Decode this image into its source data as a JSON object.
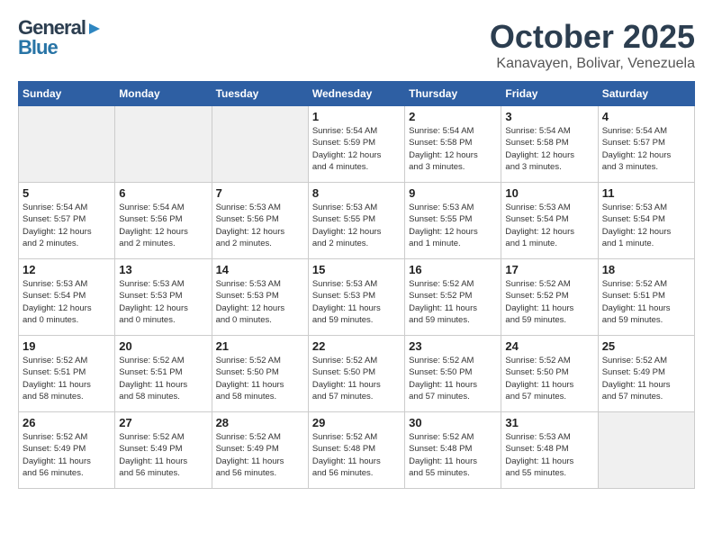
{
  "header": {
    "logo_general": "General",
    "logo_blue": "Blue",
    "month_title": "October 2025",
    "location": "Kanavayen, Bolivar, Venezuela"
  },
  "weekdays": [
    "Sunday",
    "Monday",
    "Tuesday",
    "Wednesday",
    "Thursday",
    "Friday",
    "Saturday"
  ],
  "weeks": [
    [
      {
        "num": "",
        "info": "",
        "empty": true
      },
      {
        "num": "",
        "info": "",
        "empty": true
      },
      {
        "num": "",
        "info": "",
        "empty": true
      },
      {
        "num": "1",
        "info": "Sunrise: 5:54 AM\nSunset: 5:59 PM\nDaylight: 12 hours\nand 4 minutes."
      },
      {
        "num": "2",
        "info": "Sunrise: 5:54 AM\nSunset: 5:58 PM\nDaylight: 12 hours\nand 3 minutes."
      },
      {
        "num": "3",
        "info": "Sunrise: 5:54 AM\nSunset: 5:58 PM\nDaylight: 12 hours\nand 3 minutes."
      },
      {
        "num": "4",
        "info": "Sunrise: 5:54 AM\nSunset: 5:57 PM\nDaylight: 12 hours\nand 3 minutes."
      }
    ],
    [
      {
        "num": "5",
        "info": "Sunrise: 5:54 AM\nSunset: 5:57 PM\nDaylight: 12 hours\nand 2 minutes."
      },
      {
        "num": "6",
        "info": "Sunrise: 5:54 AM\nSunset: 5:56 PM\nDaylight: 12 hours\nand 2 minutes."
      },
      {
        "num": "7",
        "info": "Sunrise: 5:53 AM\nSunset: 5:56 PM\nDaylight: 12 hours\nand 2 minutes."
      },
      {
        "num": "8",
        "info": "Sunrise: 5:53 AM\nSunset: 5:55 PM\nDaylight: 12 hours\nand 2 minutes."
      },
      {
        "num": "9",
        "info": "Sunrise: 5:53 AM\nSunset: 5:55 PM\nDaylight: 12 hours\nand 1 minute."
      },
      {
        "num": "10",
        "info": "Sunrise: 5:53 AM\nSunset: 5:54 PM\nDaylight: 12 hours\nand 1 minute."
      },
      {
        "num": "11",
        "info": "Sunrise: 5:53 AM\nSunset: 5:54 PM\nDaylight: 12 hours\nand 1 minute."
      }
    ],
    [
      {
        "num": "12",
        "info": "Sunrise: 5:53 AM\nSunset: 5:54 PM\nDaylight: 12 hours\nand 0 minutes."
      },
      {
        "num": "13",
        "info": "Sunrise: 5:53 AM\nSunset: 5:53 PM\nDaylight: 12 hours\nand 0 minutes."
      },
      {
        "num": "14",
        "info": "Sunrise: 5:53 AM\nSunset: 5:53 PM\nDaylight: 12 hours\nand 0 minutes."
      },
      {
        "num": "15",
        "info": "Sunrise: 5:53 AM\nSunset: 5:53 PM\nDaylight: 11 hours\nand 59 minutes."
      },
      {
        "num": "16",
        "info": "Sunrise: 5:52 AM\nSunset: 5:52 PM\nDaylight: 11 hours\nand 59 minutes."
      },
      {
        "num": "17",
        "info": "Sunrise: 5:52 AM\nSunset: 5:52 PM\nDaylight: 11 hours\nand 59 minutes."
      },
      {
        "num": "18",
        "info": "Sunrise: 5:52 AM\nSunset: 5:51 PM\nDaylight: 11 hours\nand 59 minutes."
      }
    ],
    [
      {
        "num": "19",
        "info": "Sunrise: 5:52 AM\nSunset: 5:51 PM\nDaylight: 11 hours\nand 58 minutes."
      },
      {
        "num": "20",
        "info": "Sunrise: 5:52 AM\nSunset: 5:51 PM\nDaylight: 11 hours\nand 58 minutes."
      },
      {
        "num": "21",
        "info": "Sunrise: 5:52 AM\nSunset: 5:50 PM\nDaylight: 11 hours\nand 58 minutes."
      },
      {
        "num": "22",
        "info": "Sunrise: 5:52 AM\nSunset: 5:50 PM\nDaylight: 11 hours\nand 57 minutes."
      },
      {
        "num": "23",
        "info": "Sunrise: 5:52 AM\nSunset: 5:50 PM\nDaylight: 11 hours\nand 57 minutes."
      },
      {
        "num": "24",
        "info": "Sunrise: 5:52 AM\nSunset: 5:50 PM\nDaylight: 11 hours\nand 57 minutes."
      },
      {
        "num": "25",
        "info": "Sunrise: 5:52 AM\nSunset: 5:49 PM\nDaylight: 11 hours\nand 57 minutes."
      }
    ],
    [
      {
        "num": "26",
        "info": "Sunrise: 5:52 AM\nSunset: 5:49 PM\nDaylight: 11 hours\nand 56 minutes."
      },
      {
        "num": "27",
        "info": "Sunrise: 5:52 AM\nSunset: 5:49 PM\nDaylight: 11 hours\nand 56 minutes."
      },
      {
        "num": "28",
        "info": "Sunrise: 5:52 AM\nSunset: 5:49 PM\nDaylight: 11 hours\nand 56 minutes."
      },
      {
        "num": "29",
        "info": "Sunrise: 5:52 AM\nSunset: 5:48 PM\nDaylight: 11 hours\nand 56 minutes."
      },
      {
        "num": "30",
        "info": "Sunrise: 5:52 AM\nSunset: 5:48 PM\nDaylight: 11 hours\nand 55 minutes."
      },
      {
        "num": "31",
        "info": "Sunrise: 5:53 AM\nSunset: 5:48 PM\nDaylight: 11 hours\nand 55 minutes."
      },
      {
        "num": "",
        "info": "",
        "empty": true
      }
    ]
  ]
}
